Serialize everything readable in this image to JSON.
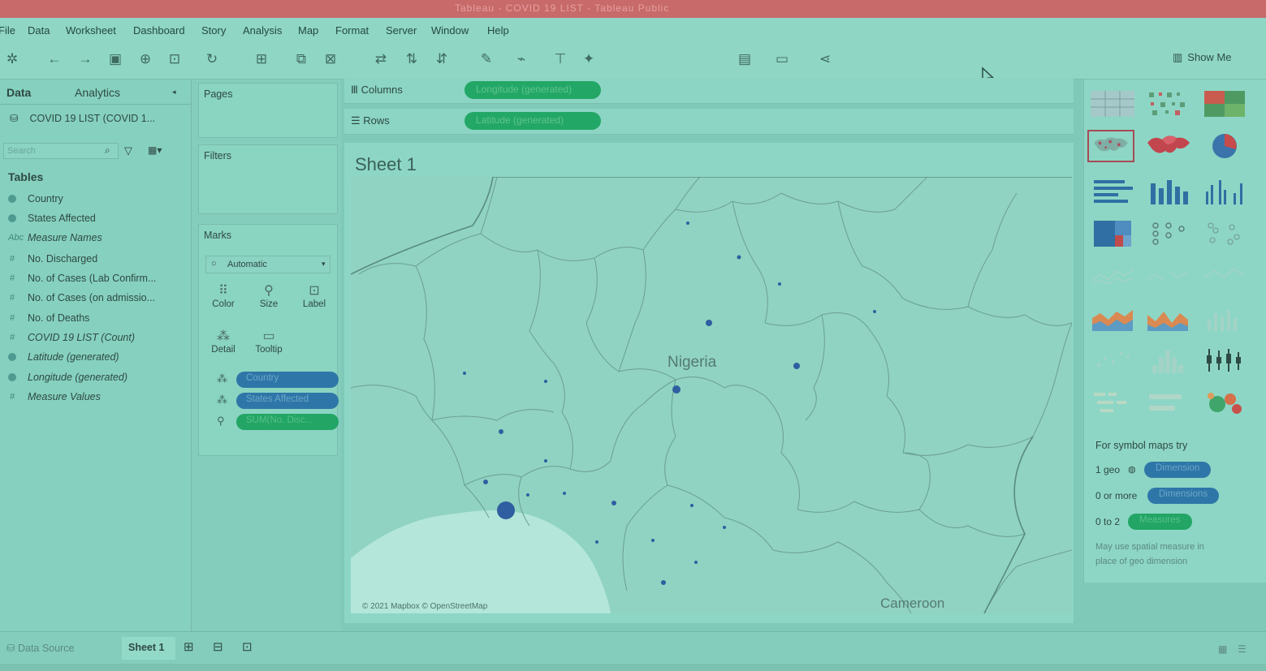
{
  "window": {
    "title": "Tableau - COVID 19 LIST - Tableau Public"
  },
  "menu": [
    "File",
    "Data",
    "Worksheet",
    "Dashboard",
    "Story",
    "Analysis",
    "Map",
    "Format",
    "Server",
    "Window",
    "Help"
  ],
  "toolbar": {
    "show_me_label": "Show Me"
  },
  "data_pane": {
    "tab_data": "Data",
    "tab_analytics": "Analytics",
    "datasource": "COVID 19 LIST (COVID 1...",
    "search_placeholder": "Search",
    "tables_heading": "Tables",
    "fields": [
      {
        "name": "Country",
        "kind": "dimension",
        "italic": false
      },
      {
        "name": "States Affected",
        "kind": "dimension",
        "italic": false
      },
      {
        "name": "Measure Names",
        "kind": "text",
        "italic": true
      },
      {
        "name": "No. Discharged",
        "kind": "measure",
        "italic": false
      },
      {
        "name": "No. of Cases (Lab Confirm...",
        "kind": "measure",
        "italic": false
      },
      {
        "name": "No. of Cases (on admissio...",
        "kind": "measure",
        "italic": false
      },
      {
        "name": "No. of Deaths",
        "kind": "measure",
        "italic": false
      },
      {
        "name": "COVID 19 LIST (Count)",
        "kind": "measure",
        "italic": true
      },
      {
        "name": "Latitude (generated)",
        "kind": "geo",
        "italic": true
      },
      {
        "name": "Longitude (generated)",
        "kind": "geo",
        "italic": true
      },
      {
        "name": "Measure Values",
        "kind": "measure",
        "italic": true
      }
    ]
  },
  "cards": {
    "pages": "Pages",
    "filters": "Filters",
    "marks": "Marks",
    "mark_type": "Automatic",
    "buttons": {
      "color": "Color",
      "size": "Size",
      "label": "Label",
      "detail": "Detail",
      "tooltip": "Tooltip"
    },
    "mark_pills": [
      "Country",
      "States Affected",
      "SUM(No. Disc..."
    ]
  },
  "shelves": {
    "columns_label": "Columns",
    "columns_pill": "Longitude (generated)",
    "rows_label": "Rows",
    "rows_pill": "Latitude (generated)"
  },
  "sheet": {
    "title": "Sheet 1",
    "map_country_label": "Nigeria",
    "map_neighbor_label": "Cameroon",
    "attribution": "© 2021 Mapbox © OpenStreetMap"
  },
  "show_me": {
    "hint_title": "For symbol maps try",
    "rows": [
      {
        "prefix": "1 geo",
        "pill": "Dimension"
      },
      {
        "prefix": "0 or more",
        "pill": "Dimensions"
      },
      {
        "prefix": "0 to 2",
        "pill": "Measures"
      }
    ],
    "note_line1": "May use spatial measure in",
    "note_line2": "place of geo dimension"
  },
  "bottom": {
    "data_source_tab": "Data Source",
    "sheet_tab": "Sheet 1"
  },
  "colors": {
    "green_pill": "#22a565",
    "blue_pill": "#2f76a8",
    "selected_thumb": "#a64a55",
    "mark": "#2f5fa0"
  }
}
